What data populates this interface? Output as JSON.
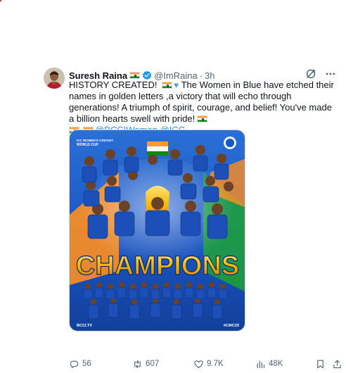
{
  "tweet": {
    "author_name": "Suresh Raina",
    "handle": "@ImRaina",
    "separator": "·",
    "time": "3h",
    "text_parts": {
      "p1": "HISTORY CREATED! ",
      "p2": " The Women in Blue have etched their names in golden letters ,a victory that will echo through generations! A triumph of spirit, courage, and belief! You've made a billion hearts swell with pride!",
      "mention1": "@BCCIWomen",
      "mention2": "@ICC"
    },
    "media": {
      "logo_line1": "ICC WOMEN'S CRICKET",
      "logo_line2": "WORLD CUP",
      "headline": "CHAMPIONS",
      "footer_left": "BCCI.TV",
      "footer_right": "#CWC25"
    },
    "actions": {
      "replies": "56",
      "reposts": "607",
      "likes": "9.7K",
      "views": "48K"
    }
  },
  "icons": [
    "verified-badge-icon",
    "grok-icon",
    "more-icon",
    "reply-icon",
    "repost-icon",
    "like-icon",
    "views-icon",
    "bookmark-icon",
    "share-icon"
  ],
  "colors": {
    "accent": "#1d9bf0",
    "text": "#0f1419",
    "muted": "#536471",
    "poster_blue": "#1f5fc8",
    "headline_gold": "#f4b400"
  }
}
